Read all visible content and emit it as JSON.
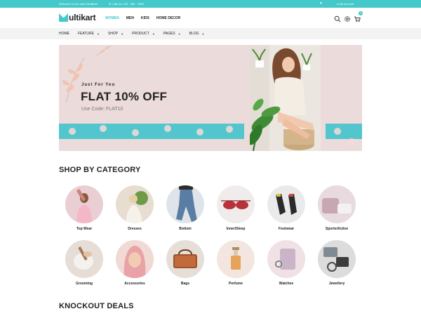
{
  "topbar": {
    "welcome": "Welcome to Our store Multikart",
    "call": "Call Us: 123 - 456 - 7890",
    "account": "My Account",
    "heart_icon": "heart-icon",
    "user_icon": "user-icon",
    "phone_icon": "phone-icon"
  },
  "header": {
    "logo_text": "ultikart",
    "nav": [
      "WOMEN",
      "MEN",
      "KIDS",
      "HOME DECOR"
    ],
    "active_nav": "WOMEN",
    "cart_count": "0"
  },
  "subnav": {
    "items": [
      {
        "label": "HOME",
        "has_menu": false
      },
      {
        "label": "FEATURE",
        "has_menu": true
      },
      {
        "label": "SHOP",
        "has_menu": true
      },
      {
        "label": "PRODUCT",
        "has_menu": true
      },
      {
        "label": "PAGES",
        "has_menu": true
      },
      {
        "label": "BLOG",
        "has_menu": true
      }
    ]
  },
  "banner": {
    "kicker": "Just For You",
    "headline": "FLAT 10% OFF",
    "code": "Use Code: FLAT10"
  },
  "category": {
    "title": "SHOP BY CATEGORY",
    "items": [
      {
        "label": "Top Wear",
        "bg": "#e9cfd3"
      },
      {
        "label": "Dresses",
        "bg": "#e7ddd0"
      },
      {
        "label": "Bottom",
        "bg": "#dfe4ea"
      },
      {
        "label": "Inner/Sleep",
        "bg": "#f1ecec"
      },
      {
        "label": "Footwear",
        "bg": "#eaeaea"
      },
      {
        "label": "Sports/Active",
        "bg": "#e8dbe0"
      },
      {
        "label": "Grooming",
        "bg": "#e6ded6"
      },
      {
        "label": "Accessories",
        "bg": "#f1d9d4"
      },
      {
        "label": "Bags",
        "bg": "#e6dfd7"
      },
      {
        "label": "Perfume",
        "bg": "#f3e6e1"
      },
      {
        "label": "Watches",
        "bg": "#f0e1e5"
      },
      {
        "label": "Jewellery",
        "bg": "#dcdcdc"
      }
    ]
  },
  "deals": {
    "title": "KNOCKOUT DEALS"
  },
  "colors": {
    "accent": "#45c8c9",
    "banner_bg": "#ebdcdb",
    "band": "#53c6cd"
  }
}
